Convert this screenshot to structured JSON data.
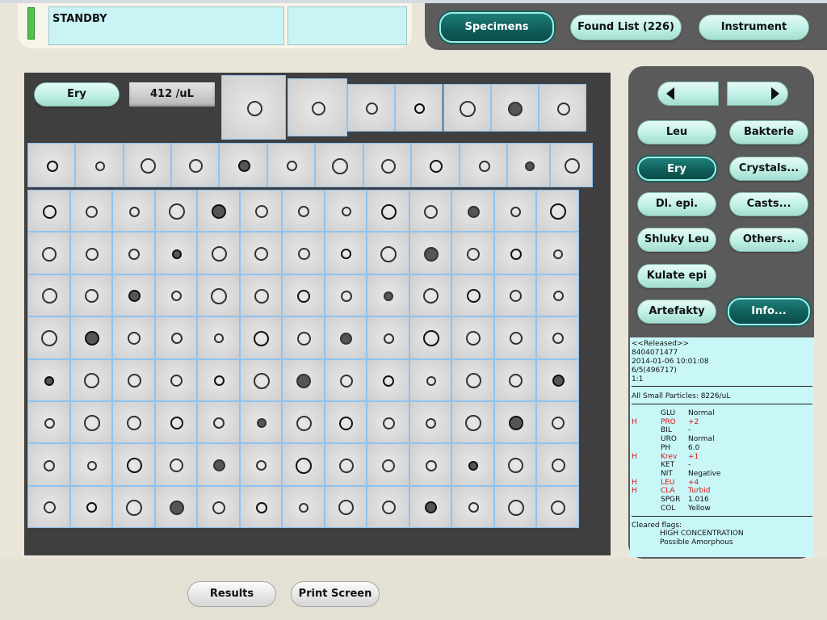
{
  "status": {
    "text": "STANDBY",
    "led_color": "#4fc44a"
  },
  "tabs": [
    {
      "label": "Specimens",
      "active": true
    },
    {
      "label": "Found List (226)",
      "active": false
    },
    {
      "label": "Instrument",
      "active": false
    }
  ],
  "grid": {
    "category": "Ery",
    "count": "412 /uL",
    "cell_count_shown": 131
  },
  "nav": {
    "prev_icon": "triangle-left-icon",
    "next_icon": "triangle-right-icon"
  },
  "categories": {
    "left": [
      "Leu",
      "Ery",
      "Dl. epi.",
      "Shluky Leu",
      "Kulate epi",
      "Artefakty"
    ],
    "right": [
      "Bakterie",
      "Crystals...",
      "Casts...",
      "Others...",
      "Info..."
    ],
    "active": "Ery"
  },
  "info": {
    "released": "<<Released>>",
    "sample_id": "8404071477",
    "datetime": "2014-01-06 10:01:08",
    "rack": "6/5(496717)",
    "dilution": "1:1",
    "small_particles": "All Small Particles: 8226/uL",
    "chemistry": [
      {
        "flag": "",
        "name": "GLU",
        "value": "Normal"
      },
      {
        "flag": "H",
        "name": "PRO",
        "value": "+2"
      },
      {
        "flag": "",
        "name": "BIL",
        "value": "-"
      },
      {
        "flag": "",
        "name": "URO",
        "value": "Normal"
      },
      {
        "flag": "",
        "name": "PH",
        "value": "6.0"
      },
      {
        "flag": "H",
        "name": "Krev",
        "value": "+1"
      },
      {
        "flag": "",
        "name": "KET",
        "value": "-"
      },
      {
        "flag": "",
        "name": "NIT",
        "value": "Negative"
      },
      {
        "flag": "H",
        "name": "LEU",
        "value": "+4"
      },
      {
        "flag": "H",
        "name": "CLA",
        "value": "Turbid"
      },
      {
        "flag": "",
        "name": "SPGR",
        "value": "1.016"
      },
      {
        "flag": "",
        "name": "COL",
        "value": "Yellow"
      }
    ],
    "cleared_flags_label": "Cleared flags:",
    "cleared_flags": [
      "HIGH CONCENTRATION",
      "Possible Amorphous"
    ]
  },
  "bottom": {
    "results_label": "Results",
    "print_label": "Print Screen"
  }
}
